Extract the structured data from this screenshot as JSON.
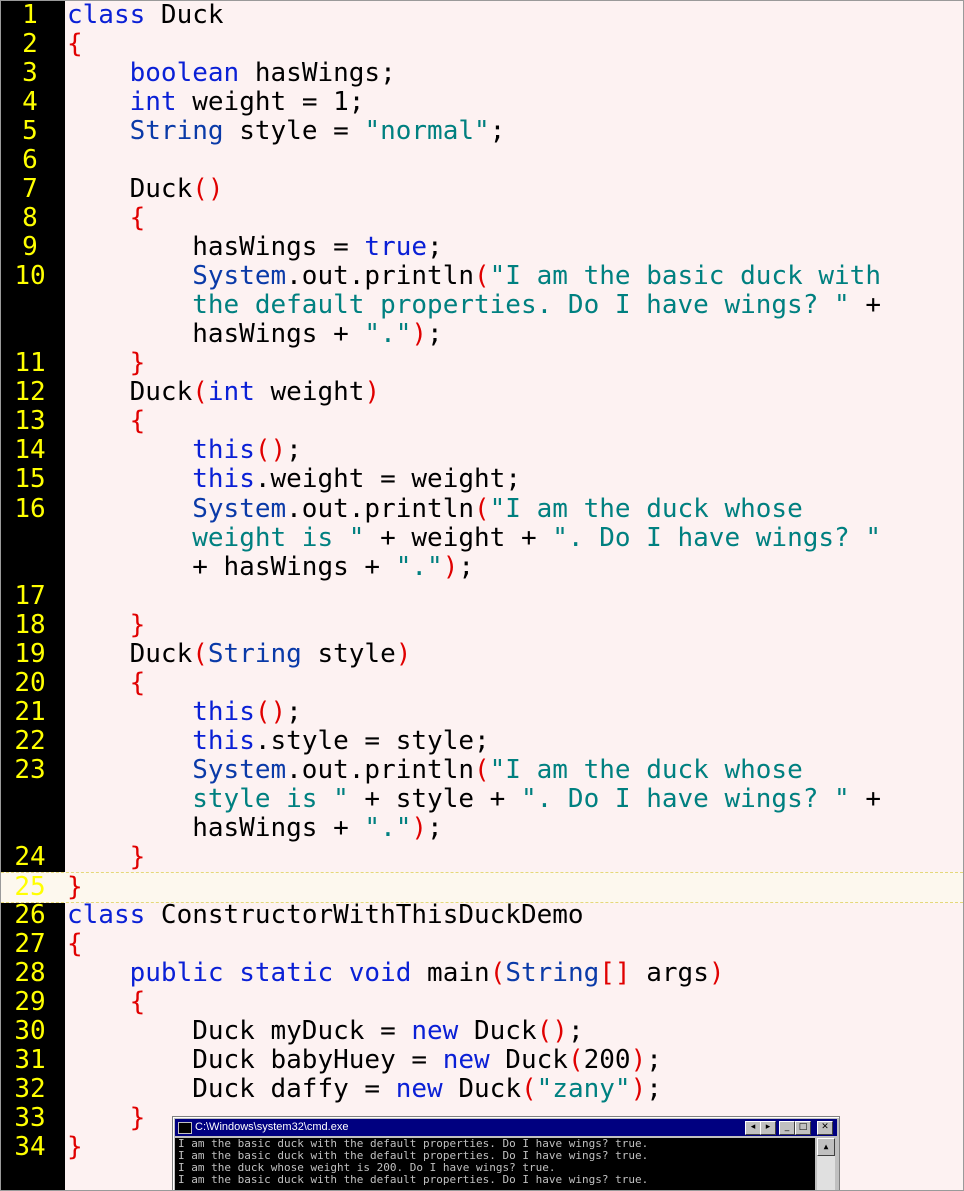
{
  "editor": {
    "lines": [
      {
        "num": "1",
        "code": [
          {
            "t": "class Duck",
            "c": "kw0"
          }
        ]
      },
      {
        "num": "2",
        "code": [
          {
            "t": "{",
            "c": "br"
          }
        ]
      },
      {
        "num": "3",
        "code": [
          {
            "t": "    "
          },
          {
            "t": "boolean",
            "c": "kw"
          },
          {
            "t": " hasWings;"
          }
        ]
      },
      {
        "num": "4",
        "code": [
          {
            "t": "    "
          },
          {
            "t": "int",
            "c": "kw"
          },
          {
            "t": " weight = 1;"
          }
        ]
      },
      {
        "num": "5",
        "code": [
          {
            "t": "    "
          },
          {
            "t": "String",
            "c": "ty"
          },
          {
            "t": " style = "
          },
          {
            "t": "\"normal\"",
            "c": "str"
          },
          {
            "t": ";"
          }
        ]
      },
      {
        "num": "6",
        "code": []
      },
      {
        "num": "7",
        "code": [
          {
            "t": "    Duck"
          },
          {
            "t": "()",
            "c": "br"
          }
        ]
      },
      {
        "num": "8",
        "code": [
          {
            "t": "    "
          },
          {
            "t": "{",
            "c": "br"
          }
        ]
      },
      {
        "num": "9",
        "code": [
          {
            "t": "        hasWings = "
          },
          {
            "t": "true",
            "c": "kw"
          },
          {
            "t": ";"
          }
        ]
      },
      {
        "num": "10",
        "code": [
          {
            "t": "        "
          },
          {
            "t": "System",
            "c": "ty"
          },
          {
            "t": ".out.println"
          },
          {
            "t": "(",
            "c": "br"
          },
          {
            "t": "\"I am the basic duck with",
            "c": "str"
          }
        ]
      },
      {
        "num": "",
        "code": [
          {
            "t": "        "
          },
          {
            "t": "the default properties. Do I have wings? \"",
            "c": "str"
          },
          {
            "t": " +"
          }
        ]
      },
      {
        "num": "",
        "code": [
          {
            "t": "        hasWings + "
          },
          {
            "t": "\".\"",
            "c": "str"
          },
          {
            "t": ")",
            "c": "br"
          },
          {
            "t": ";"
          }
        ]
      },
      {
        "num": "11",
        "code": [
          {
            "t": "    "
          },
          {
            "t": "}",
            "c": "br"
          }
        ]
      },
      {
        "num": "12",
        "code": [
          {
            "t": "    Duck"
          },
          {
            "t": "(",
            "c": "br"
          },
          {
            "t": "int",
            "c": "kw"
          },
          {
            "t": " weight"
          },
          {
            "t": ")",
            "c": "br"
          }
        ]
      },
      {
        "num": "13",
        "code": [
          {
            "t": "    "
          },
          {
            "t": "{",
            "c": "br"
          }
        ]
      },
      {
        "num": "14",
        "code": [
          {
            "t": "        "
          },
          {
            "t": "this",
            "c": "kw"
          },
          {
            "t": "()",
            "c": "br"
          },
          {
            "t": ";"
          }
        ]
      },
      {
        "num": "15",
        "code": [
          {
            "t": "        "
          },
          {
            "t": "this",
            "c": "kw"
          },
          {
            "t": ".weight = weight;"
          }
        ]
      },
      {
        "num": "16",
        "code": [
          {
            "t": "        "
          },
          {
            "t": "System",
            "c": "ty"
          },
          {
            "t": ".out.println"
          },
          {
            "t": "(",
            "c": "br"
          },
          {
            "t": "\"I am the duck whose",
            "c": "str"
          }
        ]
      },
      {
        "num": "",
        "code": [
          {
            "t": "        "
          },
          {
            "t": "weight is \"",
            "c": "str"
          },
          {
            "t": " + weight + "
          },
          {
            "t": "\". Do I have wings? \"",
            "c": "str"
          }
        ]
      },
      {
        "num": "",
        "code": [
          {
            "t": "        + hasWings + "
          },
          {
            "t": "\".\"",
            "c": "str"
          },
          {
            "t": ")",
            "c": "br"
          },
          {
            "t": ";"
          }
        ]
      },
      {
        "num": "17",
        "code": []
      },
      {
        "num": "18",
        "code": [
          {
            "t": "    "
          },
          {
            "t": "}",
            "c": "br"
          }
        ]
      },
      {
        "num": "19",
        "code": [
          {
            "t": "    Duck"
          },
          {
            "t": "(",
            "c": "br"
          },
          {
            "t": "String",
            "c": "ty"
          },
          {
            "t": " style"
          },
          {
            "t": ")",
            "c": "br"
          }
        ]
      },
      {
        "num": "20",
        "code": [
          {
            "t": "    "
          },
          {
            "t": "{",
            "c": "br"
          }
        ]
      },
      {
        "num": "21",
        "code": [
          {
            "t": "        "
          },
          {
            "t": "this",
            "c": "kw"
          },
          {
            "t": "()",
            "c": "br"
          },
          {
            "t": ";"
          }
        ]
      },
      {
        "num": "22",
        "code": [
          {
            "t": "        "
          },
          {
            "t": "this",
            "c": "kw"
          },
          {
            "t": ".style = style;"
          }
        ]
      },
      {
        "num": "23",
        "code": [
          {
            "t": "        "
          },
          {
            "t": "System",
            "c": "ty"
          },
          {
            "t": ".out.println"
          },
          {
            "t": "(",
            "c": "br"
          },
          {
            "t": "\"I am the duck whose",
            "c": "str"
          }
        ]
      },
      {
        "num": "",
        "code": [
          {
            "t": "        "
          },
          {
            "t": "style is \"",
            "c": "str"
          },
          {
            "t": " + style + "
          },
          {
            "t": "\". Do I have wings? \"",
            "c": "str"
          },
          {
            "t": " +"
          }
        ]
      },
      {
        "num": "",
        "code": [
          {
            "t": "        hasWings + "
          },
          {
            "t": "\".\"",
            "c": "str"
          },
          {
            "t": ")",
            "c": "br"
          },
          {
            "t": ";"
          }
        ]
      },
      {
        "num": "24",
        "code": [
          {
            "t": "    "
          },
          {
            "t": "}",
            "c": "br"
          }
        ]
      },
      {
        "num": "25",
        "code": [
          {
            "t": "}",
            "c": "br"
          }
        ],
        "highlight": true
      },
      {
        "num": "26",
        "code": [
          {
            "t": "class ConstructorWithThisDuckDemo",
            "c": "kw0"
          }
        ]
      },
      {
        "num": "27",
        "code": [
          {
            "t": "{",
            "c": "br"
          }
        ]
      },
      {
        "num": "28",
        "code": [
          {
            "t": "    "
          },
          {
            "t": "public",
            "c": "kw"
          },
          {
            "t": " "
          },
          {
            "t": "static",
            "c": "kw"
          },
          {
            "t": " "
          },
          {
            "t": "void",
            "c": "kw"
          },
          {
            "t": " main"
          },
          {
            "t": "(",
            "c": "br"
          },
          {
            "t": "String",
            "c": "ty"
          },
          {
            "t": "[]",
            "c": "br"
          },
          {
            "t": " args"
          },
          {
            "t": ")",
            "c": "br"
          }
        ]
      },
      {
        "num": "29",
        "code": [
          {
            "t": "    "
          },
          {
            "t": "{",
            "c": "br"
          }
        ]
      },
      {
        "num": "30",
        "code": [
          {
            "t": "        Duck myDuck = "
          },
          {
            "t": "new",
            "c": "kw"
          },
          {
            "t": " Duck"
          },
          {
            "t": "()",
            "c": "br"
          },
          {
            "t": ";"
          }
        ]
      },
      {
        "num": "31",
        "code": [
          {
            "t": "        Duck babyHuey = "
          },
          {
            "t": "new",
            "c": "kw"
          },
          {
            "t": " Duck"
          },
          {
            "t": "(",
            "c": "br"
          },
          {
            "t": "200"
          },
          {
            "t": ")",
            "c": "br"
          },
          {
            "t": ";"
          }
        ]
      },
      {
        "num": "32",
        "code": [
          {
            "t": "        Duck daffy = "
          },
          {
            "t": "new",
            "c": "kw"
          },
          {
            "t": " Duck"
          },
          {
            "t": "(",
            "c": "br"
          },
          {
            "t": "\"zany\"",
            "c": "str"
          },
          {
            "t": ")",
            "c": "br"
          },
          {
            "t": ";"
          }
        ]
      },
      {
        "num": "33",
        "code": [
          {
            "t": "    "
          },
          {
            "t": "}",
            "c": "br"
          }
        ]
      },
      {
        "num": "34",
        "code": [
          {
            "t": "}",
            "c": "br"
          }
        ]
      }
    ]
  },
  "cmd": {
    "title": "C:\\Windows\\system32\\cmd.exe",
    "buttons": {
      "scroll_left": "◂",
      "scroll_right": "▸",
      "minimize": "_",
      "maximize": "□",
      "close": "✕"
    },
    "output": [
      "I am the basic duck with the default properties. Do I have wings? true.",
      "I am the basic duck with the default properties. Do I have wings? true.",
      "I am the duck whose weight is 200. Do I have wings? true.",
      "I am the basic duck with the default properties. Do I have wings? true."
    ],
    "scroll_up": "▲"
  },
  "colors": {
    "keyword": "#0a20d6",
    "string": "#008080",
    "bracket": "#e00000",
    "line_number": "#ffff00",
    "gutter": "#000000",
    "background": "#fdf2f2"
  }
}
